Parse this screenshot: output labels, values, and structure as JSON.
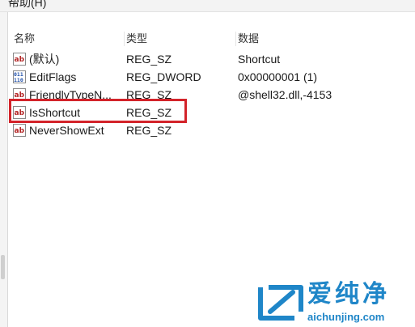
{
  "menu": {
    "help_label": "帮助(H)"
  },
  "columns": {
    "name": "名称",
    "type": "类型",
    "data": "数据"
  },
  "rows": [
    {
      "name": "(默认)",
      "type": "REG_SZ",
      "data": "Shortcut",
      "icon": "string-value-icon"
    },
    {
      "name": "EditFlags",
      "type": "REG_DWORD",
      "data": "0x00000001 (1)",
      "icon": "binary-value-icon"
    },
    {
      "name": "FriendlyTypeN...",
      "type": "REG_SZ",
      "data": "@shell32.dll,-4153",
      "icon": "string-value-icon"
    },
    {
      "name": "IsShortcut",
      "type": "REG_SZ",
      "data": "",
      "icon": "string-value-icon"
    },
    {
      "name": "NeverShowExt",
      "type": "REG_SZ",
      "data": "",
      "icon": "string-value-icon"
    }
  ],
  "highlighted_row": "IsShortcut",
  "colors": {
    "highlight_border": "#d3232a",
    "watermark": "#1f86c8"
  },
  "watermark": {
    "brand_text": "爱纯净",
    "url_text": "aichunjing.com"
  }
}
